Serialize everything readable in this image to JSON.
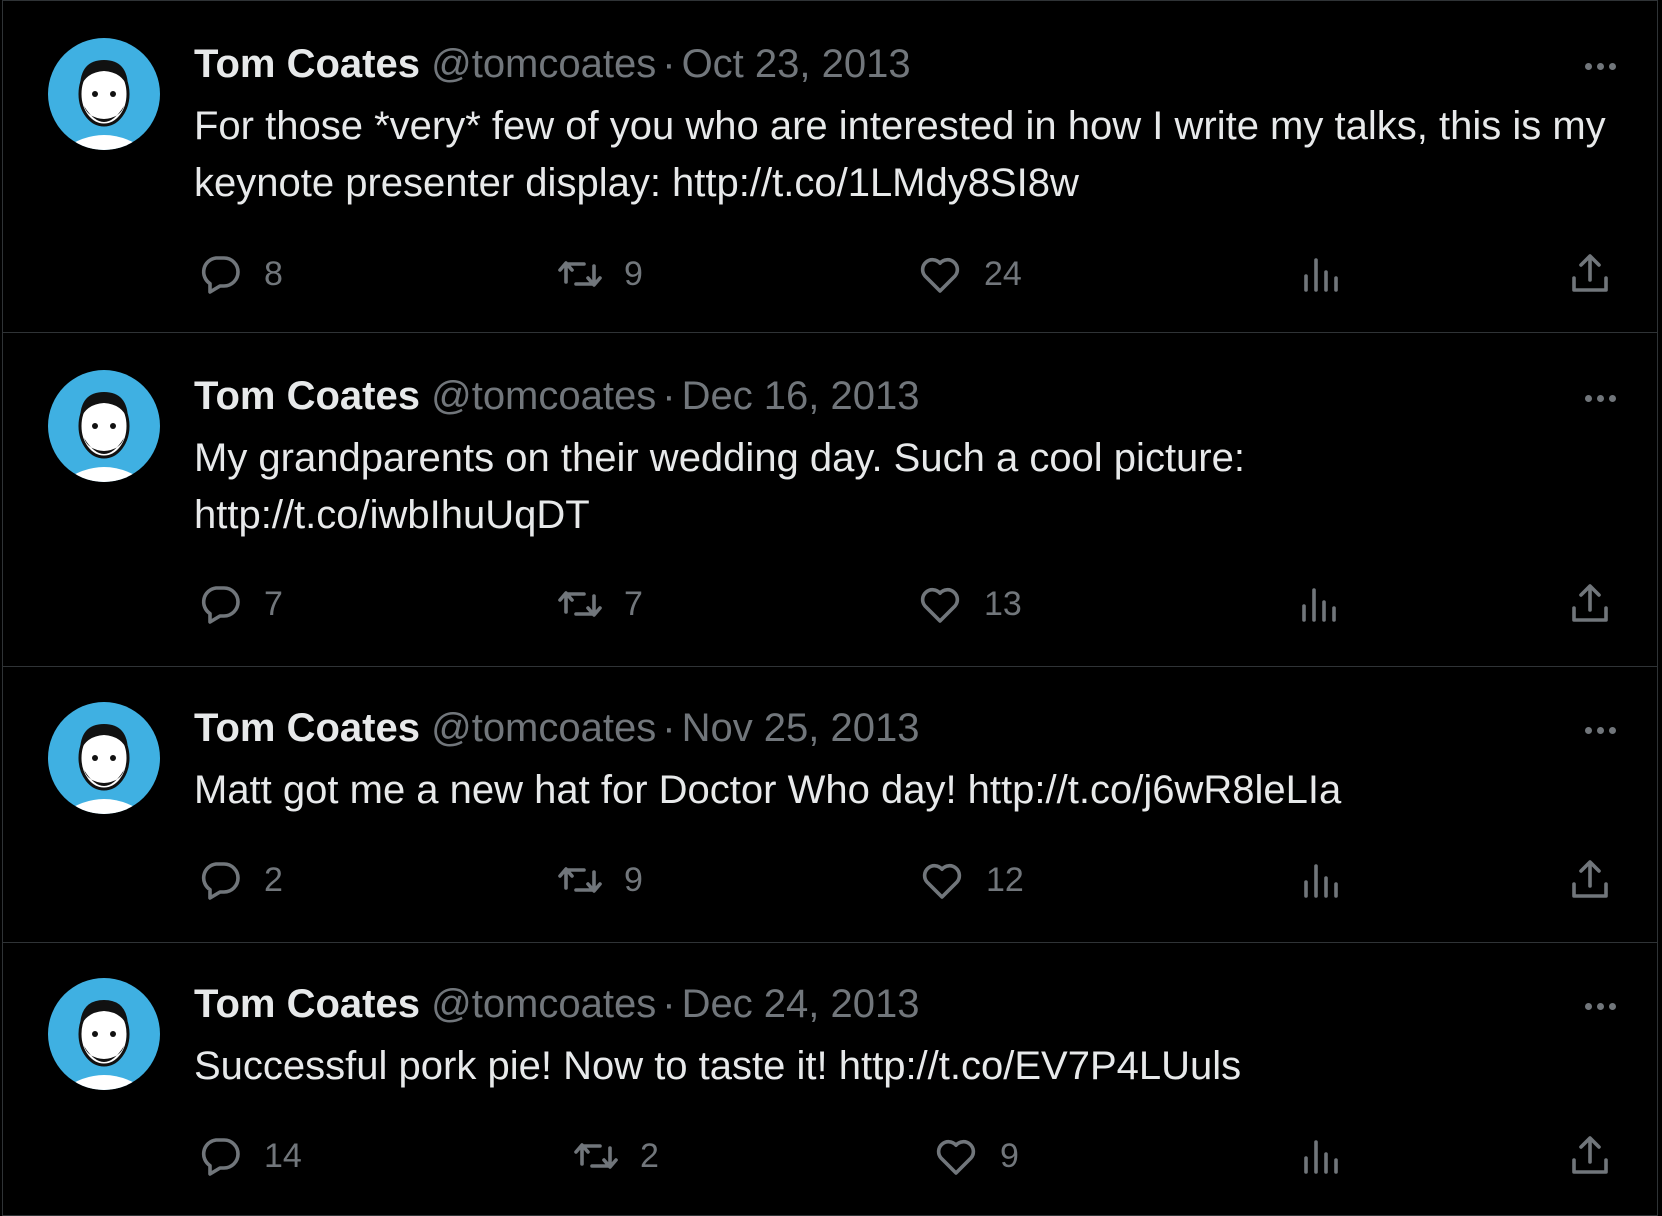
{
  "tweets": [
    {
      "author": "Tom Coates",
      "handle": "@tomcoates",
      "separator": "·",
      "date": "Oct 23, 2013",
      "text": "For those *very* few of you who are interested in how I write my talks, this is my keynote presenter display: http://t.co/1LMdy8SI8w",
      "replies": "8",
      "retweets": "9",
      "likes": "24"
    },
    {
      "author": "Tom Coates",
      "handle": "@tomcoates",
      "separator": "·",
      "date": "Dec 16, 2013",
      "text": "My grandparents on their wedding day. Such a cool picture: http://t.co/iwbIhuUqDT",
      "replies": "7",
      "retweets": "7",
      "likes": "13"
    },
    {
      "author": "Tom Coates",
      "handle": "@tomcoates",
      "separator": "·",
      "date": "Nov 25, 2013",
      "text": "Matt got me a new hat for Doctor Who day! http://t.co/j6wR8leLIa",
      "replies": "2",
      "retweets": "9",
      "likes": "12"
    },
    {
      "author": "Tom Coates",
      "handle": "@tomcoates",
      "separator": "·",
      "date": "Dec 24, 2013",
      "text": "Successful pork pie! Now to taste it! http://t.co/EV7P4LUuls",
      "replies": "14",
      "retweets": "2",
      "likes": "9"
    }
  ],
  "icons": {
    "avatar": "avatar-illustration",
    "more": "more-icon",
    "reply": "reply-icon",
    "retweet": "retweet-icon",
    "like": "like-icon",
    "views": "views-icon",
    "share": "share-icon"
  },
  "colors": {
    "background": "#000000",
    "primary_text": "#e7e9ea",
    "secondary_text": "#71767b",
    "divider": "#2f3336",
    "avatar_blue": "#3fb0e2"
  }
}
